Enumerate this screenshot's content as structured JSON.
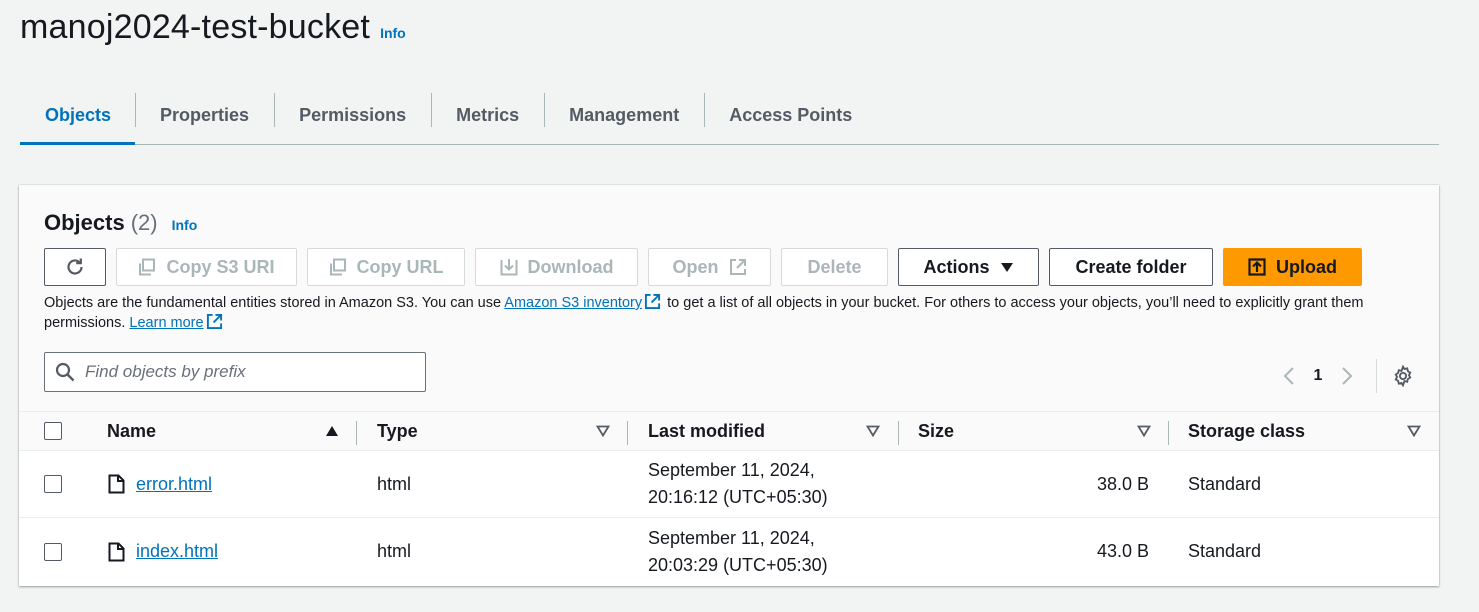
{
  "header": {
    "title": "manoj2024-test-bucket",
    "info": "Info"
  },
  "tabs": [
    {
      "label": "Objects",
      "active": true
    },
    {
      "label": "Properties"
    },
    {
      "label": "Permissions"
    },
    {
      "label": "Metrics"
    },
    {
      "label": "Management"
    },
    {
      "label": "Access Points"
    }
  ],
  "panel": {
    "title": "Objects",
    "count": "(2)",
    "info": "Info",
    "toolbar": {
      "refresh_icon": "refresh-icon",
      "copy_s3_uri": "Copy S3 URI",
      "copy_url": "Copy URL",
      "download": "Download",
      "open": "Open",
      "delete": "Delete",
      "actions": "Actions",
      "create_folder": "Create folder",
      "upload": "Upload"
    },
    "description": {
      "part1": "Objects are the fundamental entities stored in Amazon S3. You can use ",
      "inventory_link": "Amazon S3 inventory",
      "part2": " to get a list of all objects in your bucket. For others to access your objects, you’ll need to explicitly grant them permissions. ",
      "learn_more": "Learn more"
    },
    "search": {
      "placeholder": "Find objects by prefix"
    },
    "pagination": {
      "current_page": "1"
    }
  },
  "table": {
    "columns": [
      "Name",
      "Type",
      "Last modified",
      "Size",
      "Storage class"
    ],
    "rows": [
      {
        "name": "error.html",
        "type": "html",
        "modified_line1": "September 11, 2024,",
        "modified_line2": "20:16:12 (UTC+05:30)",
        "size": "38.0 B",
        "storage": "Standard"
      },
      {
        "name": "index.html",
        "type": "html",
        "modified_line1": "September 11, 2024,",
        "modified_line2": "20:03:29 (UTC+05:30)",
        "size": "43.0 B",
        "storage": "Standard"
      }
    ]
  },
  "colors": {
    "link": "#0073bb",
    "primary": "#ff9900",
    "text": "#16191f",
    "muted": "#545b64"
  }
}
